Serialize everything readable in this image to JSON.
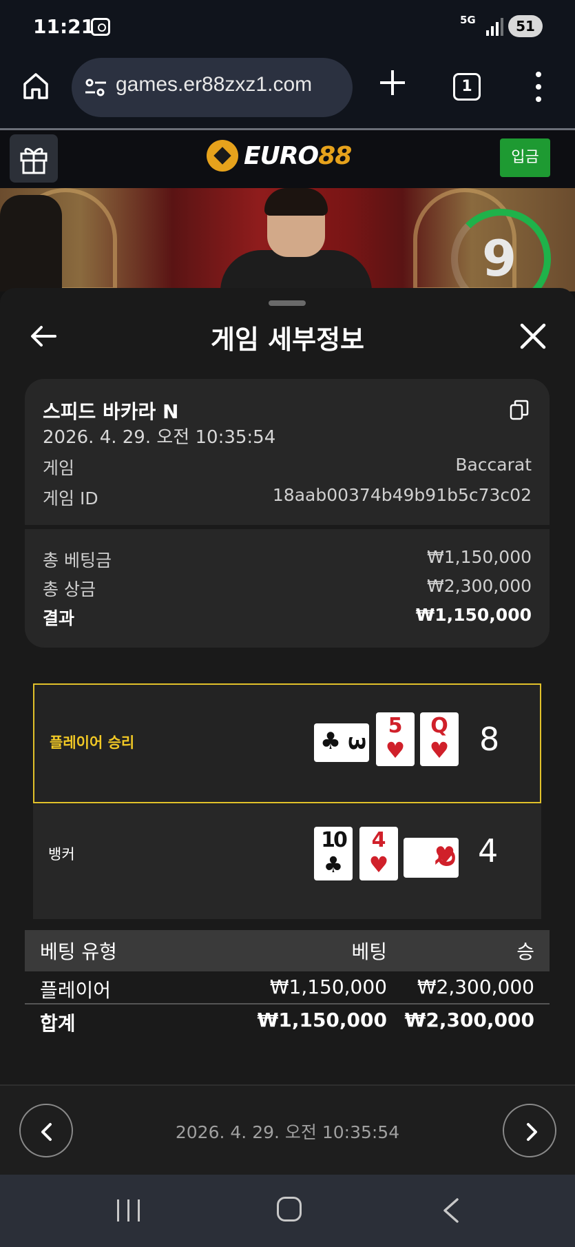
{
  "status_bar": {
    "time": "11:21",
    "network": "5G",
    "battery": "51"
  },
  "browser": {
    "url": "games.er88zxz1.com",
    "tab_count": "1"
  },
  "site": {
    "logo_main": "EURO",
    "logo_accent": "88",
    "deposit_label": "입금"
  },
  "video": {
    "timer": "9"
  },
  "sheet": {
    "title": "게임 세부정보",
    "game_name": "스피드 바카라 N",
    "datetime": "2026. 4. 29. 오전 10:35:54",
    "game_label": "게임",
    "game_value": "Baccarat",
    "game_id_label": "게임 ID",
    "game_id_value": "18aab00374b49b91b5c73c02",
    "total_bet_label": "총 베팅금",
    "total_bet_value": "₩1,150,000",
    "total_win_label": "총 상금",
    "total_win_value": "₩2,300,000",
    "result_label": "결과",
    "result_value": "₩1,150,000"
  },
  "hands": {
    "player": {
      "label": "플레이어 승리",
      "total": "8",
      "cards": [
        {
          "rank": "3",
          "suit": "♣",
          "color": "#111111"
        },
        {
          "rank": "5",
          "suit": "♥",
          "color": "#d0202a"
        },
        {
          "rank": "Q",
          "suit": "♥",
          "color": "#d0202a"
        }
      ]
    },
    "banker": {
      "label": "뱅커",
      "total": "4",
      "cards": [
        {
          "rank": "10",
          "suit": "♣",
          "color": "#111111"
        },
        {
          "rank": "4",
          "suit": "♥",
          "color": "#d0202a"
        },
        {
          "rank": "Q",
          "suit": "♥",
          "color": "#d0202a"
        }
      ]
    }
  },
  "bet_table": {
    "headers": [
      "베팅 유형",
      "베팅",
      "승"
    ],
    "rows": [
      {
        "type": "플레이어",
        "bet": "₩1,150,000",
        "win": "₩2,300,000"
      }
    ],
    "total": {
      "type": "합계",
      "bet": "₩1,150,000",
      "win": "₩2,300,000"
    }
  },
  "footer": {
    "datetime": "2026. 4. 29. 오전 10:35:54"
  },
  "colors": {
    "accent_win": "#f2c925",
    "deposit": "#1e9a32",
    "logo_gold": "#e6a21c",
    "timer_ring": "#1fb24a"
  }
}
